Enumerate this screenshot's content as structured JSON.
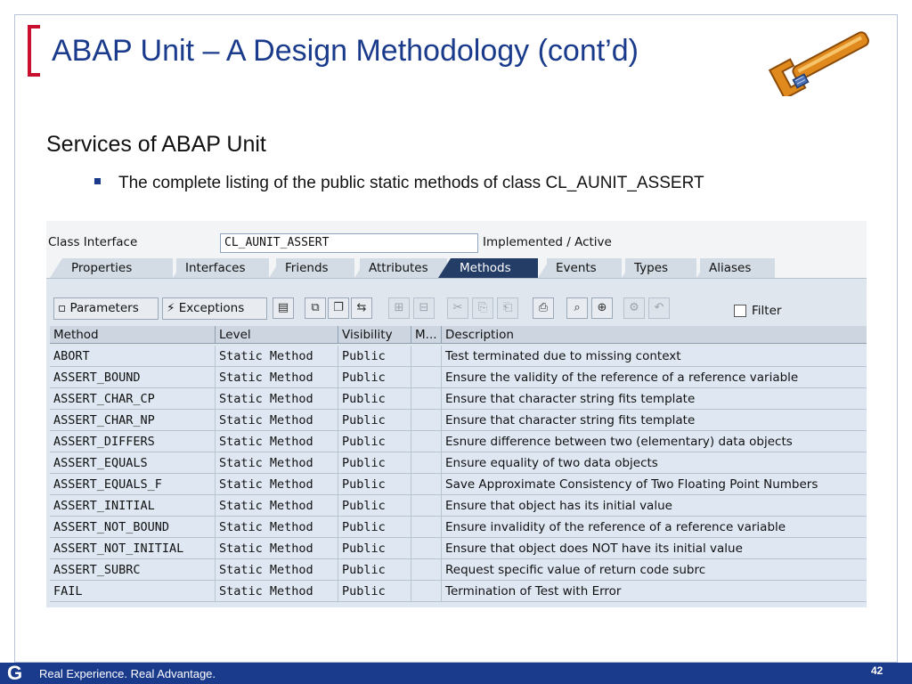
{
  "slide": {
    "title": "ABAP Unit – A Design Methodology (cont’d)",
    "subtitle": "Services of ABAP Unit",
    "bullet": "The complete listing of the public static methods of class CL_AUNIT_ASSERT",
    "footer_text": "Real Experience. Real Advantage.",
    "logo_letter": "G",
    "page_number": "42"
  },
  "sap": {
    "class_interface_label": "Class Interface",
    "class_interface_value": "CL_AUNIT_ASSERT",
    "status": "Implemented / Active",
    "tabs": [
      "Properties",
      "Interfaces",
      "Friends",
      "Attributes",
      "Methods",
      "Events",
      "Types",
      "Aliases"
    ],
    "active_tab": "Methods",
    "toolbar": {
      "parameters_label": "Parameters",
      "exceptions_label": "Exceptions",
      "filter_label": "Filter"
    },
    "columns": [
      "Method",
      "Level",
      "Visibility",
      "M...",
      "Description"
    ],
    "rows": [
      {
        "method": "ABORT",
        "level": "Static Method",
        "visibility": "Public",
        "m": "",
        "description": "Test terminated due to missing context"
      },
      {
        "method": "ASSERT_BOUND",
        "level": "Static Method",
        "visibility": "Public",
        "m": "",
        "description": "Ensure the validity of the reference of a reference variable"
      },
      {
        "method": "ASSERT_CHAR_CP",
        "level": "Static Method",
        "visibility": "Public",
        "m": "",
        "description": "Ensure that character string fits template"
      },
      {
        "method": "ASSERT_CHAR_NP",
        "level": "Static Method",
        "visibility": "Public",
        "m": "",
        "description": "Ensure that character string fits template"
      },
      {
        "method": "ASSERT_DIFFERS",
        "level": "Static Method",
        "visibility": "Public",
        "m": "",
        "description": "Esnure difference between two (elementary) data objects"
      },
      {
        "method": "ASSERT_EQUALS",
        "level": "Static Method",
        "visibility": "Public",
        "m": "",
        "description": "Ensure equality of two data objects"
      },
      {
        "method": "ASSERT_EQUALS_F",
        "level": "Static Method",
        "visibility": "Public",
        "m": "",
        "description": "Save Approximate Consistency of Two Floating Point Numbers"
      },
      {
        "method": "ASSERT_INITIAL",
        "level": "Static Method",
        "visibility": "Public",
        "m": "",
        "description": "Ensure that object has its initial value"
      },
      {
        "method": "ASSERT_NOT_BOUND",
        "level": "Static Method",
        "visibility": "Public",
        "m": "",
        "description": "Ensure invalidity of the reference of a reference variable"
      },
      {
        "method": "ASSERT_NOT_INITIAL",
        "level": "Static Method",
        "visibility": "Public",
        "m": "",
        "description": "Ensure that object does NOT have its initial value"
      },
      {
        "method": "ASSERT_SUBRC",
        "level": "Static Method",
        "visibility": "Public",
        "m": "",
        "description": "Request specific value of return code subrc"
      },
      {
        "method": "FAIL",
        "level": "Static Method",
        "visibility": "Public",
        "m": "",
        "description": "Termination of Test with Error"
      }
    ]
  },
  "colors": {
    "title_blue": "#1a3a8c",
    "bracket_red": "#c8102e",
    "active_tab": "#243d66"
  }
}
